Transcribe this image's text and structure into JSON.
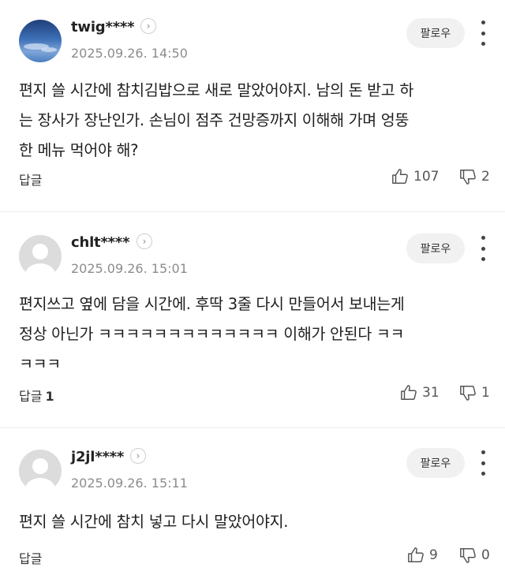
{
  "comments": [
    {
      "username": "twig****",
      "timestamp": "2025.09.26. 14:50",
      "follow_label": "팔로우",
      "body_lines": [
        "편지 쓸 시간에 참치김밥으로 새로 말았어야지. 남의 돈 받고 하",
        "는 장사가 장난인가. 손님이 점주 건망증까지 이해해 가며 엉뚱",
        "한 메뉴 먹어야 해?"
      ],
      "reply_label": "답글",
      "reply_count": "",
      "likes": "107",
      "dislikes": "2",
      "avatar": "sky-photo"
    },
    {
      "username": "chlt****",
      "timestamp": "2025.09.26. 15:01",
      "follow_label": "팔로우",
      "body_lines": [
        "편지쓰고 옆에 담을 시간에. 후딱 3줄 다시 만들어서 보내는게",
        "정상 아닌가 ㅋㅋㅋㅋㅋㅋㅋㅋㅋㅋㅋㅋㅋ 이해가 안된다 ㅋㅋ",
        "ㅋㅋㅋ"
      ],
      "reply_label": "답글",
      "reply_count": "1",
      "likes": "31",
      "dislikes": "1",
      "avatar": "default"
    },
    {
      "username": "j2jl****",
      "timestamp": "2025.09.26. 15:11",
      "follow_label": "팔로우",
      "body_lines": [
        "편지 쓸 시간에 참치 넣고 다시 말았어야지."
      ],
      "reply_label": "답글",
      "reply_count": "",
      "likes": "9",
      "dislikes": "0",
      "avatar": "default"
    }
  ],
  "icons": {
    "profile": "chevron-right-icon",
    "more": "more-vertical-icon",
    "like": "thumbs-up-icon",
    "dislike": "thumbs-down-icon"
  }
}
